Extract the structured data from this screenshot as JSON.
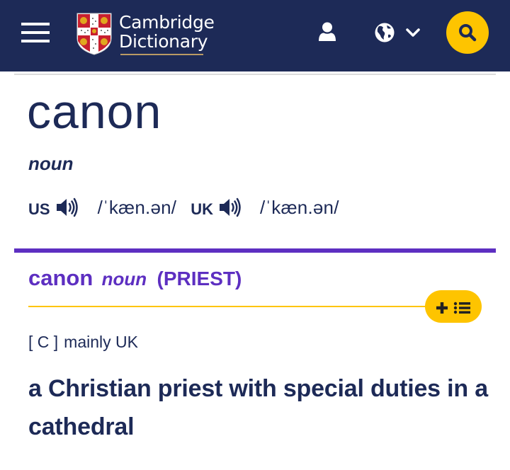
{
  "header": {
    "logo_line1": "Cambridge",
    "logo_line2": "Dictionary",
    "icons": [
      "menu-icon",
      "shield-logo",
      "user-icon",
      "globe-icon",
      "chevron-down-icon",
      "search-icon"
    ],
    "colors": {
      "background": "#1d2a57",
      "search_button": "#fec400",
      "logo_underline": "#b99a64"
    }
  },
  "entry": {
    "headword": "canon",
    "pos": "noun",
    "pronunciations": [
      {
        "region": "US",
        "ipa": "/ˈkæn.ən/",
        "icon": "speaker-icon"
      },
      {
        "region": "UK",
        "ipa": "/ˈkæn.ən/",
        "icon": "speaker-icon"
      }
    ]
  },
  "sense": {
    "headword": "canon",
    "pos": "noun",
    "guideword": "(PRIEST)",
    "grammar_code": "[ C ]",
    "usage_label": "mainly UK",
    "definition": "a Christian priest with special duties in a cathedral",
    "add_to_wordlist_icon": "plus-list-icon",
    "colors": {
      "accent": "#5d2fc1",
      "divider": "#fec400",
      "text": "#1d2a57"
    }
  }
}
